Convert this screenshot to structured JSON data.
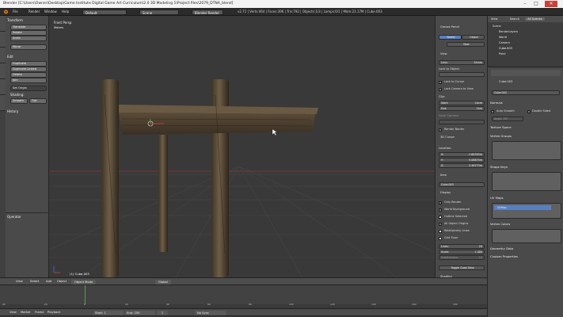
{
  "window": {
    "title": "Blender [C:\\Users\\Owner\\Desktop\\Game Institute Digital Game Art Curriculum\\2.0 3D Modeling 1\\Project files\\2079_DTNA_blend]"
  },
  "menu": {
    "items": [
      "File",
      "Render",
      "Window",
      "Help"
    ],
    "layout": "Default",
    "scene": "Scene",
    "engine": "Blender Render",
    "stats": "v2.71 | Verts:464 | Faces:396 | Tris:792 | Objects:1/3 | Lamps:0/1 | Mem:21.17M | Cube.003"
  },
  "toolshelf": {
    "vtabs": [
      "Tools",
      "Create",
      "Relations",
      "Animation",
      "Physics",
      "Grease Pencil"
    ],
    "transform_header": "Transform",
    "transform_buttons": [
      "Translate",
      "Rotate",
      "Scale",
      "Mirror"
    ],
    "edit_header": "Edit",
    "edit_buttons": [
      "Duplicate",
      "Duplicate Linked",
      "Delete",
      "Join"
    ],
    "set_origin": "Set Origin",
    "shading_label": "Shading:",
    "smooth": "Smooth",
    "flat": "Flat",
    "history_header": "History",
    "operator_header": "Operator"
  },
  "viewport": {
    "view_label": "Front Persp",
    "units": "Meters",
    "object_label": "(1) Cube.003"
  },
  "npanel": {
    "grease_header": "Grease Pencil",
    "scene_btn": "Scene",
    "object_btn": "Object",
    "new_btn": "New",
    "view_header": "View",
    "lens_label": "Lens:",
    "lens_value": "35mm",
    "lock_object": "Lock to Object:",
    "lock_cursor": "Lock to Cursor",
    "lock_camera": "Lock Camera to View",
    "clip_label": "Clip:",
    "clip_start": "Start:",
    "clip_start_value": "10cm",
    "clip_end": "End:",
    "clip_end_value": "1km",
    "local_camera": "Local Camera:",
    "render_border": "Render Border",
    "cursor_header": "3D Cursor",
    "location_label": "Location:",
    "x_label": "X:",
    "x_value": "-7.60395m",
    "y_label": "Y:",
    "y_value": "5.08874m",
    "z_label": "Z:",
    "z_value": "3.38773m",
    "item_header": "Item",
    "item_name": "Cube.003",
    "display_header": "Display",
    "only_render": "Only Render",
    "world_background": "World Background",
    "outline_selected": "Outline Selected",
    "all_object_origins": "All Object Origins",
    "relationship_lines": "Relationship Lines",
    "grid_floor": "Grid Floor",
    "lines_label": "Lines:",
    "lines_value": "20",
    "scale_label": "Scale:",
    "scale_value": "1.000",
    "subdivisions_label": "Subdivisions:",
    "subdivisions_value": "10",
    "toggle_quad": "Toggle Quad View",
    "shading_header": "Shading"
  },
  "outliner": {
    "view": "View",
    "search": "Search",
    "scope": "All Scenes",
    "items": [
      "Scene",
      "RenderLayers",
      "World",
      "Camera",
      "Cube.003",
      "Point"
    ]
  },
  "properties": {
    "object_name": "Cube.003",
    "normals_header": "Normals",
    "auto_smooth": "Auto Smooth",
    "double_sided": "Double Sided",
    "angle": "Angle: 30°",
    "texture_space": "Texture Space",
    "vertex_groups": "Vertex Groups",
    "shape_keys": "Shape Keys",
    "uv_maps": "UV Maps",
    "uv_map_name": "UVMap",
    "vertex_colors": "Vertex Colors",
    "geometry_data": "Geometry Data",
    "custom_properties": "Custom Properties"
  },
  "view3d_header": {
    "items": [
      "View",
      "Select",
      "Add",
      "Object"
    ],
    "mode": "Object Mode",
    "pivot": "Global"
  },
  "timeline": {
    "ticks": [
      "-40",
      "-20",
      "0",
      "20",
      "40",
      "60",
      "80",
      "100",
      "120",
      "140",
      "160",
      "180",
      "200",
      "220",
      "240",
      "260",
      "280",
      "300",
      "320",
      "340",
      "360",
      "380",
      "400",
      "420",
      "440",
      "460",
      "480",
      "500",
      "520",
      "540",
      "560",
      "580",
      "600"
    ],
    "menu": [
      "View",
      "Marker",
      "Frame",
      "Playback"
    ],
    "start_label": "Start:",
    "start_value": "1",
    "end_label": "End:",
    "end_value": "250",
    "current": "1",
    "sync": "No Sync"
  },
  "colors": {
    "accent": "#5680c2",
    "cursor_red": "#d33f3f",
    "wood": "#6b5a43"
  }
}
